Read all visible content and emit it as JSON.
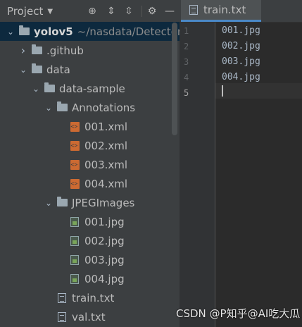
{
  "project_panel": {
    "title": "Project",
    "toolbar_icons": [
      "locate-icon",
      "expand-all-icon",
      "collapse-all-icon",
      "settings-icon",
      "hide-icon"
    ]
  },
  "tree": [
    {
      "label": "yolov5",
      "path": "~/nasdata/Detector/YO",
      "type": "folder",
      "expanded": true,
      "level": 0,
      "selected": true
    },
    {
      "label": ".github",
      "type": "folder",
      "expanded": false,
      "level": 1
    },
    {
      "label": "data",
      "type": "folder",
      "expanded": true,
      "level": 1
    },
    {
      "label": "data-sample",
      "type": "folder",
      "expanded": true,
      "level": 2
    },
    {
      "label": "Annotations",
      "type": "folder",
      "expanded": true,
      "level": 3
    },
    {
      "label": "001.xml",
      "type": "xml",
      "level": 4
    },
    {
      "label": "002.xml",
      "type": "xml",
      "level": 4
    },
    {
      "label": "003.xml",
      "type": "xml",
      "level": 4
    },
    {
      "label": "004.xml",
      "type": "xml",
      "level": 4
    },
    {
      "label": "JPEGImages",
      "type": "folder",
      "expanded": true,
      "level": 3
    },
    {
      "label": "001.jpg",
      "type": "image",
      "level": 4
    },
    {
      "label": "002.jpg",
      "type": "image",
      "level": 4
    },
    {
      "label": "003.jpg",
      "type": "image",
      "level": 4
    },
    {
      "label": "004.jpg",
      "type": "image",
      "level": 4
    },
    {
      "label": "train.txt",
      "type": "text",
      "level": 3
    },
    {
      "label": "val.txt",
      "type": "text",
      "level": 3
    }
  ],
  "editor": {
    "tab_label": "train.txt",
    "lines": [
      "001.jpg",
      "002.jpg",
      "003.jpg",
      "004.jpg",
      ""
    ],
    "line_numbers": [
      "1",
      "2",
      "3",
      "4",
      "5"
    ],
    "current_line": 5
  },
  "watermark": "CSDN @P知乎@AI吃大瓜",
  "colors": {
    "panel_bg": "#3c3f41",
    "editor_bg": "#2b2b2b",
    "selection": "#0d293e",
    "tab_underline": "#4a88c7"
  }
}
